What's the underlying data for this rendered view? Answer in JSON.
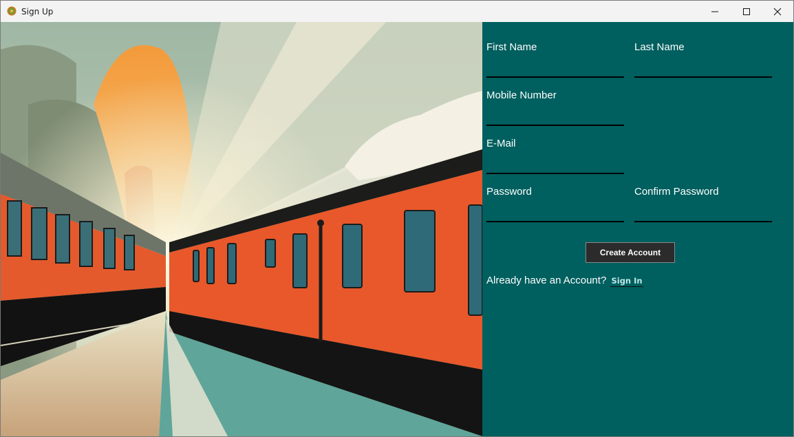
{
  "window": {
    "title": "Sign Up"
  },
  "form": {
    "first_name": {
      "label": "First Name",
      "value": ""
    },
    "last_name": {
      "label": "Last Name",
      "value": ""
    },
    "mobile": {
      "label": "Mobile Number",
      "value": ""
    },
    "email": {
      "label": "E-Mail",
      "value": ""
    },
    "password": {
      "label": "Password",
      "value": ""
    },
    "confirm_password": {
      "label": "Confirm Password",
      "value": ""
    },
    "create_button": "Create Account",
    "signin_prompt": "Already have an Account?",
    "signin_link": "Sign In"
  },
  "colors": {
    "form_bg": "#005f5f",
    "titlebar_bg": "#f3f3f3",
    "button_bg": "#2b2b2b"
  },
  "hero": {
    "description_icon": "train-illustration"
  }
}
